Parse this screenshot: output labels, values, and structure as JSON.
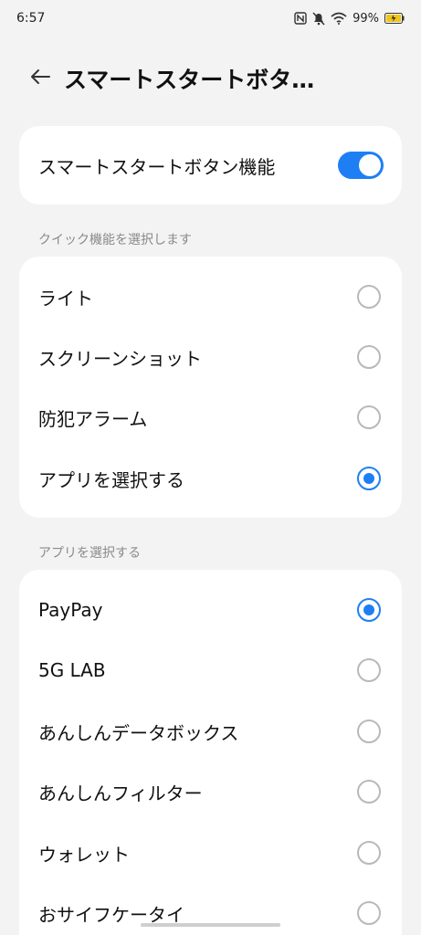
{
  "status_bar": {
    "time": "6:57",
    "battery": "99%",
    "icons": [
      "nfc-icon",
      "notifications-muted-icon",
      "wifi-icon",
      "battery-charging-icon"
    ]
  },
  "header": {
    "back_icon": "back-arrow-icon",
    "title": "スマートスタートボタ…"
  },
  "toggle": {
    "label": "スマートスタートボタン機能",
    "enabled": true
  },
  "quick_section": {
    "title": "クイック機能を選択します",
    "options": [
      {
        "label": "ライト",
        "selected": false
      },
      {
        "label": "スクリーンショット",
        "selected": false
      },
      {
        "label": "防犯アラーム",
        "selected": false
      },
      {
        "label": "アプリを選択する",
        "selected": true
      }
    ]
  },
  "app_section": {
    "title": "アプリを選択する",
    "options": [
      {
        "label": "PayPay",
        "selected": true
      },
      {
        "label": "5G LAB",
        "selected": false
      },
      {
        "label": "あんしんデータボックス",
        "selected": false
      },
      {
        "label": "あんしんフィルター",
        "selected": false
      },
      {
        "label": "ウォレット",
        "selected": false
      },
      {
        "label": "おサイフケータイ",
        "selected": false
      }
    ]
  },
  "colors": {
    "accent": "#1e7ff5",
    "background": "#f3f3f3",
    "card": "#ffffff"
  }
}
